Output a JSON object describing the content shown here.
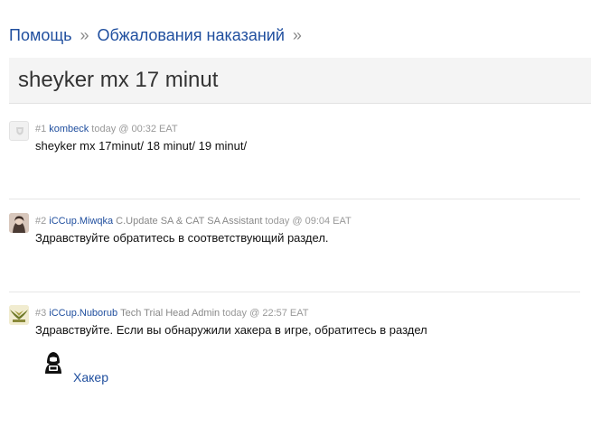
{
  "breadcrumb": {
    "items": [
      "Помощь",
      "Обжалования наказаний"
    ],
    "separator": "»"
  },
  "topic": {
    "title": "sheyker mx 17 minut"
  },
  "posts": [
    {
      "number": "#1",
      "author": "kombeck",
      "role": "",
      "time": "today @ 00:32 EAT",
      "text": "sheyker mx 17minut/ 18 minut/ 19 minut/"
    },
    {
      "number": "#2",
      "author": "iCCup.Miwqka",
      "role": "C.Update SA & CAT SA Assistant",
      "time": "today @ 09:04 EAT",
      "text": "Здравствуйте обратитесь в соответствующий раздел."
    },
    {
      "number": "#3",
      "author": "iCCup.Nuborub",
      "role": "Tech Trial Head Admin",
      "time": "today @ 22:57 EAT",
      "text": "Здравствуйте. Если вы обнаружили хакера в игре, обратитесь в раздел",
      "link_label": "Хакер",
      "link_icon": "hacker-icon"
    }
  ],
  "colors": {
    "link": "#1f4e9e",
    "muted": "#999999",
    "title_bg": "#f4f4f4"
  }
}
